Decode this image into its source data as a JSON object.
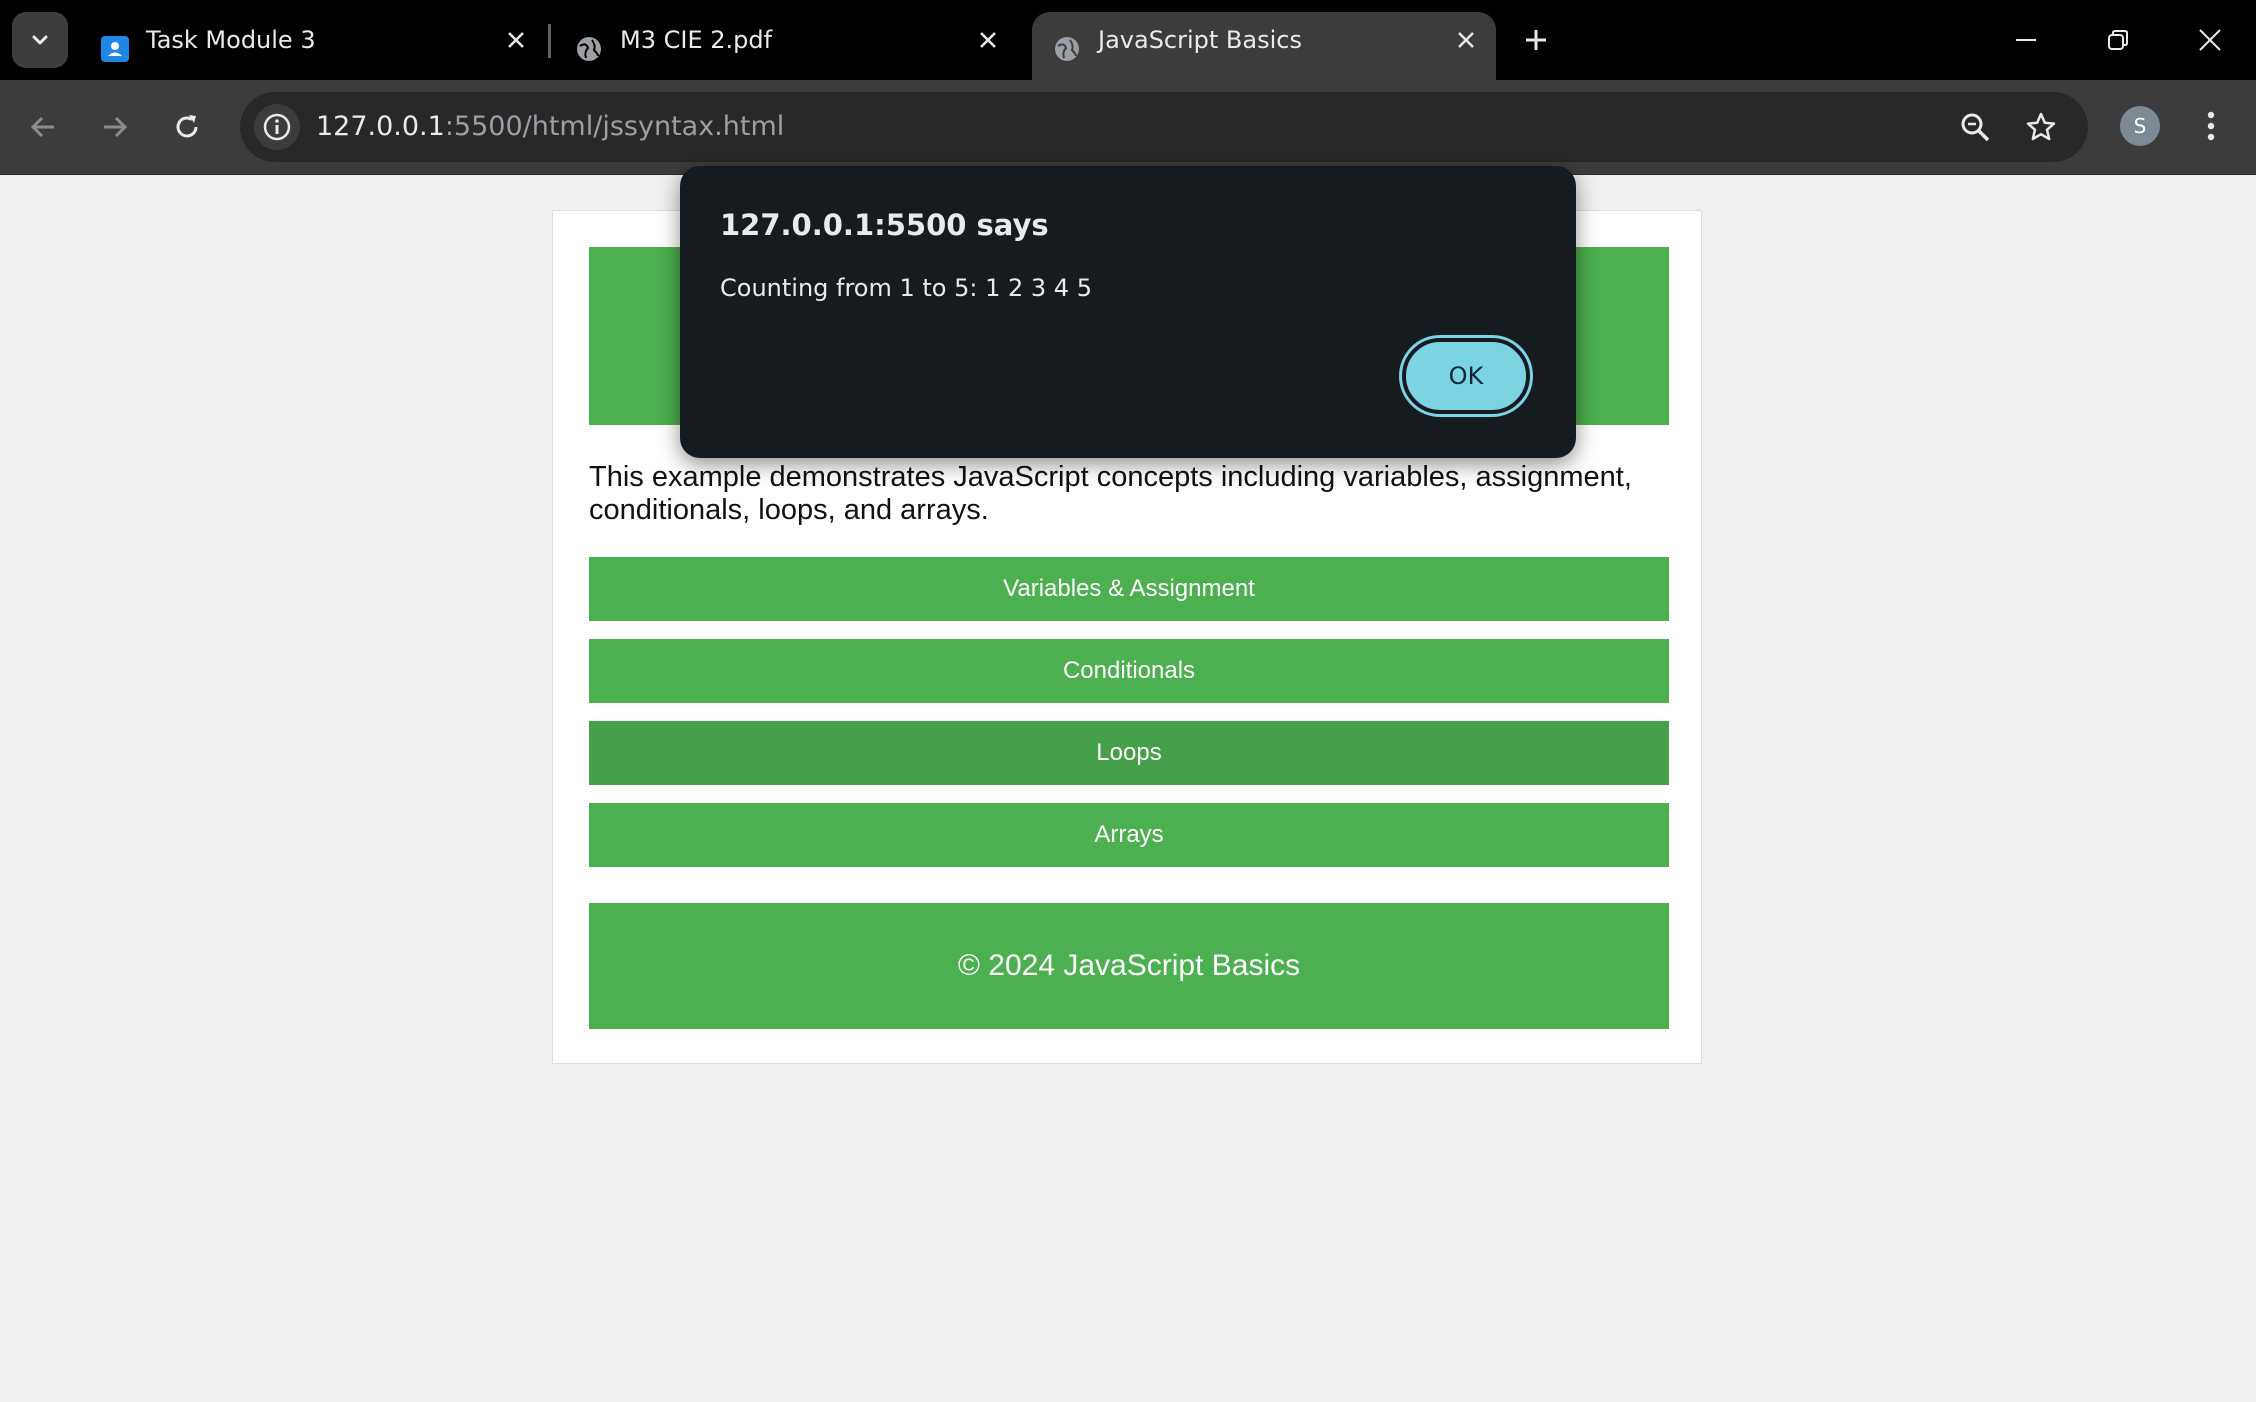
{
  "browser": {
    "tabs": [
      {
        "title": "Task Module 3",
        "icon": "classroom-icon",
        "active": false
      },
      {
        "title": "M3 CIE 2.pdf",
        "icon": "globe-icon",
        "active": false
      },
      {
        "title": "JavaScript Basics",
        "icon": "globe-icon",
        "active": true
      }
    ],
    "address": {
      "host": "127.0.0.1",
      "rest": ":5500/html/jssyntax.html"
    },
    "profile_initial": "S"
  },
  "page": {
    "intro": "This example demonstrates JavaScript concepts including variables, assignment, conditionals, loops, and arrays.",
    "buttons": [
      "Variables & Assignment",
      "Conditionals",
      "Loops",
      "Arrays"
    ],
    "footer": "© 2024 JavaScript Basics",
    "accent_color": "#4caf50",
    "hover_color": "#45a049"
  },
  "dialog": {
    "title": "127.0.0.1:5500 says",
    "message": "Counting from 1 to 5: 1 2 3 4 5",
    "ok_label": "OK"
  }
}
